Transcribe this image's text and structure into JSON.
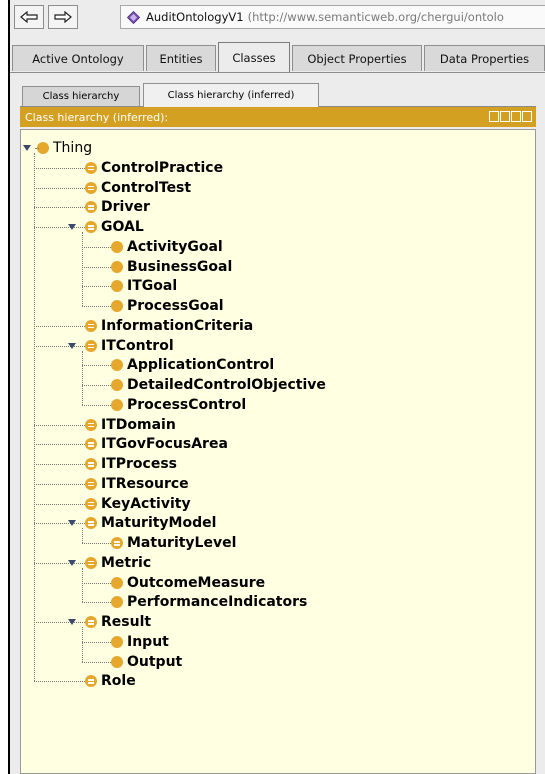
{
  "nav": {
    "back_label": "back",
    "forward_label": "forward",
    "ontology_name": "AuditOntologyV1",
    "ontology_uri": "(http://www.semanticweb.org/chergui/ontolo"
  },
  "main_tabs": [
    {
      "label": "Active Ontology"
    },
    {
      "label": "Entities"
    },
    {
      "label": "Classes"
    },
    {
      "label": "Object Properties"
    },
    {
      "label": "Data Properties"
    }
  ],
  "sub_tabs": [
    {
      "label": "Class hierarchy"
    },
    {
      "label": "Class hierarchy (inferred)"
    }
  ],
  "panel": {
    "title": "Class hierarchy (inferred):"
  },
  "tree": [
    {
      "label": "Thing",
      "level": 0,
      "kind": "dot",
      "expanded": true
    },
    {
      "label": "ControlPractice",
      "level": 1,
      "kind": "eq"
    },
    {
      "label": "ControlTest",
      "level": 1,
      "kind": "eq"
    },
    {
      "label": "Driver",
      "level": 1,
      "kind": "eq"
    },
    {
      "label": "GOAL",
      "level": 1,
      "kind": "eq",
      "expanded": true
    },
    {
      "label": "ActivityGoal",
      "level": 2,
      "kind": "dot"
    },
    {
      "label": "BusinessGoal",
      "level": 2,
      "kind": "dot"
    },
    {
      "label": "ITGoal",
      "level": 2,
      "kind": "dot"
    },
    {
      "label": "ProcessGoal",
      "level": 2,
      "kind": "dot"
    },
    {
      "label": "InformationCriteria",
      "level": 1,
      "kind": "eq"
    },
    {
      "label": "ITControl",
      "level": 1,
      "kind": "eq",
      "expanded": true
    },
    {
      "label": "ApplicationControl",
      "level": 2,
      "kind": "dot"
    },
    {
      "label": "DetailedControlObjective",
      "level": 2,
      "kind": "dot"
    },
    {
      "label": "ProcessControl",
      "level": 2,
      "kind": "dot"
    },
    {
      "label": "ITDomain",
      "level": 1,
      "kind": "eq"
    },
    {
      "label": "ITGovFocusArea",
      "level": 1,
      "kind": "eq"
    },
    {
      "label": "ITProcess",
      "level": 1,
      "kind": "eq"
    },
    {
      "label": "ITResource",
      "level": 1,
      "kind": "eq"
    },
    {
      "label": "KeyActivity",
      "level": 1,
      "kind": "eq"
    },
    {
      "label": "MaturityModel",
      "level": 1,
      "kind": "eq",
      "expanded": true
    },
    {
      "label": "MaturityLevel",
      "level": 2,
      "kind": "eq"
    },
    {
      "label": "Metric",
      "level": 1,
      "kind": "eq",
      "expanded": true
    },
    {
      "label": "OutcomeMeasure",
      "level": 2,
      "kind": "dot"
    },
    {
      "label": "PerformanceIndicators",
      "level": 2,
      "kind": "dot"
    },
    {
      "label": "Result",
      "level": 1,
      "kind": "eq",
      "expanded": true
    },
    {
      "label": "Input",
      "level": 2,
      "kind": "dot"
    },
    {
      "label": "Output",
      "level": 2,
      "kind": "dot"
    },
    {
      "label": "Role",
      "level": 1,
      "kind": "eq"
    }
  ],
  "colors": {
    "header": "#d3a021",
    "bullet": "#e5a82d",
    "tree_bg": "#ffffe2"
  }
}
